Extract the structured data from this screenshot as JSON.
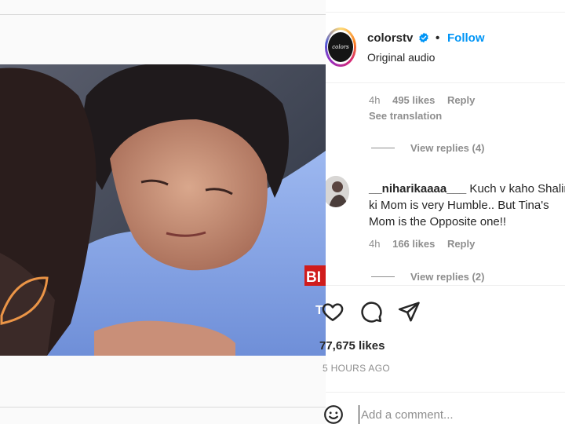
{
  "post": {
    "username": "colorstv",
    "separator": "•",
    "follow_label": "Follow",
    "audio_label": "Original audio",
    "avatar_text": "colors"
  },
  "comments": [
    {
      "time": "4h",
      "likes": "495 likes",
      "reply_label": "Reply",
      "see_translation": "See translation",
      "view_replies": "View replies (4)"
    },
    {
      "username": "__niharikaaaa___",
      "text": " Kuch v kaho Shalin ki Mom is very Humble.. But Tina's Mom is the Opposite one!!",
      "time": "4h",
      "likes": "166 likes",
      "reply_label": "Reply",
      "view_replies": "View replies (2)"
    }
  ],
  "video_overlay": {
    "badge_text": "BI",
    "side_letter": "T"
  },
  "stats": {
    "likes": "77,675 likes",
    "time_ago": "5 HOURS AGO"
  },
  "comment_box": {
    "placeholder": "Add a comment..."
  },
  "colors": {
    "accent": "#0095f6",
    "muted": "#8e8e8e",
    "text": "#262626",
    "verified": "#0095f6"
  },
  "icons": [
    "verified-badge-icon",
    "heart-icon",
    "comment-icon",
    "share-icon",
    "emoji-icon"
  ]
}
